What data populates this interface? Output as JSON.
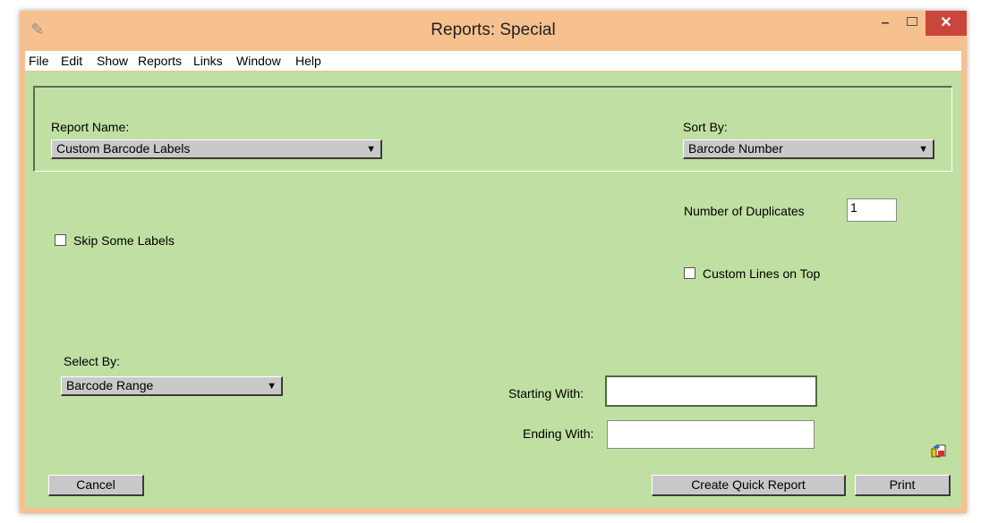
{
  "window": {
    "title": "Reports: Special",
    "app_icon": "app-logo-icon",
    "minimize": "–",
    "close": "✕"
  },
  "menu": [
    "File",
    "Edit",
    "Show",
    "Reports",
    "Links",
    "Window",
    "Help"
  ],
  "report_name": {
    "label": "Report Name:",
    "value": "Custom Barcode Labels"
  },
  "sort_by": {
    "label": "Sort By:",
    "value": "Barcode Number"
  },
  "duplicates": {
    "label": "Number of Duplicates",
    "value": "1"
  },
  "skip_labels": {
    "label": "Skip Some Labels",
    "checked": false
  },
  "custom_lines": {
    "label": "Custom Lines on Top",
    "checked": false
  },
  "select_by": {
    "label": "Select By:",
    "value": "Barcode Range"
  },
  "starting_with": {
    "label": "Starting With:",
    "value": ""
  },
  "ending_with": {
    "label": "Ending With:",
    "value": ""
  },
  "buttons": {
    "cancel": "Cancel",
    "quick_report": "Create Quick Report",
    "print": "Print"
  },
  "icons": {
    "dropdown": "▼",
    "export_icon": "export-icon"
  },
  "colors": {
    "title_bar": "#f7c08f",
    "panel": "#bfe0a2",
    "close": "#c9463d"
  }
}
